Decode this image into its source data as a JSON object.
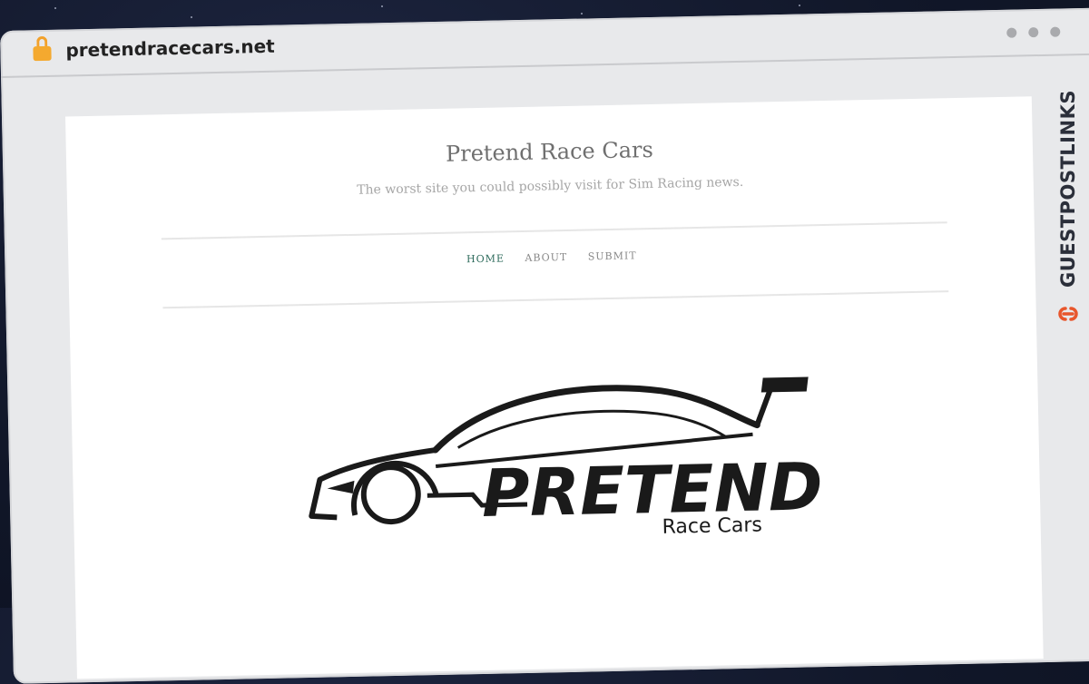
{
  "browser": {
    "url": "pretendracecars.net",
    "lock_icon": "lock-icon",
    "window_dots": [
      "dot",
      "dot",
      "dot"
    ]
  },
  "site": {
    "title": "Pretend Race Cars",
    "tagline": "The worst site you could possibly visit for Sim Racing news."
  },
  "nav": {
    "items": [
      {
        "label": "HOME",
        "active": true
      },
      {
        "label": "ABOUT",
        "active": false
      },
      {
        "label": "SUBMIT",
        "active": false
      }
    ]
  },
  "logo": {
    "word": "PRETEND",
    "subword": "Race Cars"
  },
  "sidebrand": {
    "text": "GUESTPOSTLINKS",
    "icon": "link-icon",
    "accent": "#e8562c"
  }
}
